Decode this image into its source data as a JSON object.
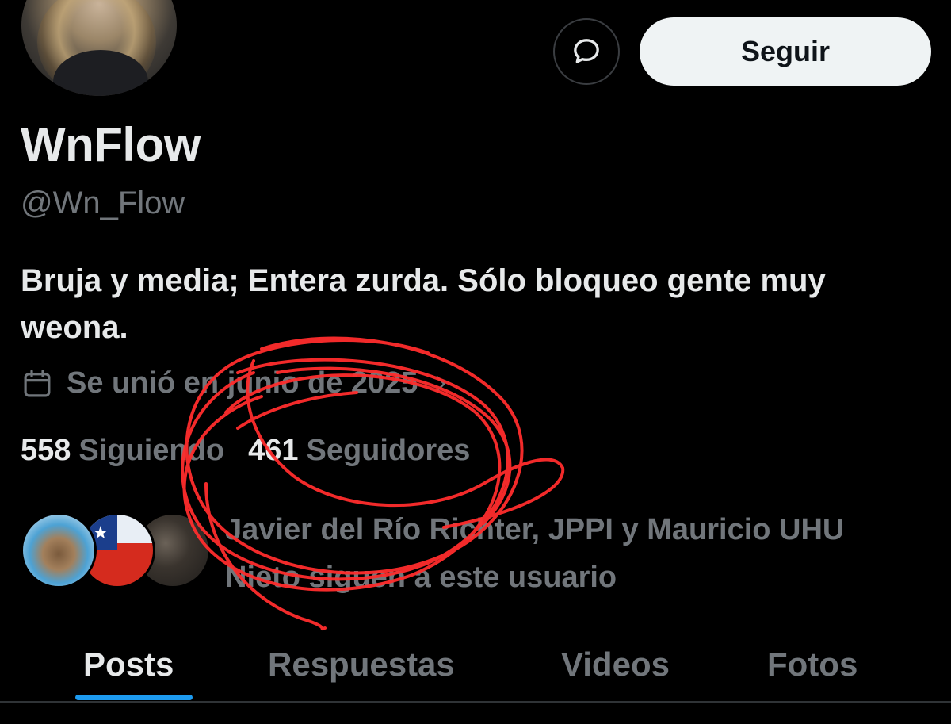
{
  "profile": {
    "name": "WnFlow",
    "handle": "@Wn_Flow",
    "bio": "Bruja y media; Entera zurda. Sólo bloqueo gente muy weona.",
    "joined": "Se unió en junio de 2025",
    "following_count": "558",
    "following_label": "Siguiendo",
    "followers_count": "461",
    "followers_label": "Seguidores"
  },
  "actions": {
    "follow_label": "Seguir",
    "message_icon": "message-bubble-icon"
  },
  "followers_you_know": "Javier del Río Richter, JPPI y Mauricio UHU Nieto siguen a este usuario",
  "tabs": [
    {
      "label": "Posts",
      "active": true
    },
    {
      "label": "Respuestas",
      "active": false
    },
    {
      "label": "Videos",
      "active": false
    },
    {
      "label": "Fotos",
      "active": false
    }
  ],
  "colors": {
    "background": "#000000",
    "text_primary": "#e7e9ea",
    "text_secondary": "#71767b",
    "accent": "#1d9bf0",
    "annotation": "#ff2d2d"
  }
}
